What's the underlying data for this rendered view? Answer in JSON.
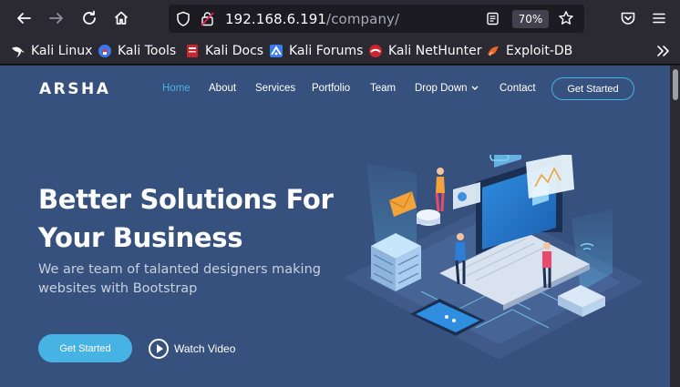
{
  "browser": {
    "url_host": "192.168.6.191",
    "url_path": "/company/",
    "zoom": "70%"
  },
  "bookmarks": [
    {
      "label": "Kali Linux",
      "icon": "kali-dragon-icon"
    },
    {
      "label": "Kali Tools",
      "icon": "kali-tools-icon"
    },
    {
      "label": "Kali Docs",
      "icon": "kali-docs-icon"
    },
    {
      "label": "Kali Forums",
      "icon": "kali-forums-icon"
    },
    {
      "label": "Kali NetHunter",
      "icon": "nethunter-icon"
    },
    {
      "label": "Exploit-DB",
      "icon": "exploit-db-icon"
    }
  ],
  "site": {
    "logo": "ARSHA",
    "nav": [
      {
        "label": "Home",
        "active": true
      },
      {
        "label": "About"
      },
      {
        "label": "Services"
      },
      {
        "label": "Portfolio"
      },
      {
        "label": "Team"
      },
      {
        "label": "Drop Down"
      },
      {
        "label": "Contact"
      }
    ],
    "cta": "Get Started"
  },
  "hero": {
    "title_line1": "Better Solutions For",
    "title_line2": "Your Business",
    "subtitle_line1": "We are team of talanted designers making",
    "subtitle_line2": "websites with Bootstrap",
    "primary_button": "Get Started",
    "secondary_button": "Watch Video"
  },
  "colors": {
    "page_bg": "#37517e",
    "accent": "#47b2e4",
    "chrome_bg": "#2b2a33"
  }
}
